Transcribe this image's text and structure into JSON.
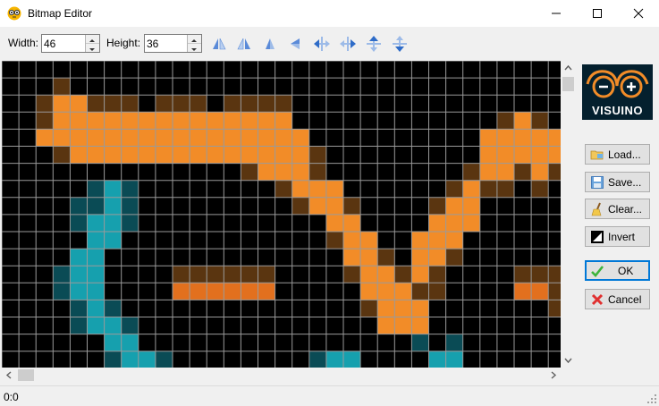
{
  "window": {
    "title": "Bitmap Editor",
    "app_icon": "visuino-owl-icon"
  },
  "toolbar": {
    "width_label": "Width:",
    "width_value": "46",
    "height_label": "Height:",
    "height_value": "36",
    "tools": [
      "mirror-horizontal-left-icon",
      "mirror-horizontal-right-icon",
      "flip-vertical-icon",
      "flip-left-icon",
      "shift-left-icon",
      "shift-right-icon",
      "shift-up-icon",
      "shift-down-icon"
    ]
  },
  "logo": {
    "text": "VISUINO"
  },
  "buttons": {
    "load": "Load...",
    "save": "Save...",
    "clear": "Clear...",
    "invert": "Invert",
    "ok": "OK",
    "cancel": "Cancel"
  },
  "status": {
    "text": "0:0"
  },
  "colors": {
    "orange": "#f28c28",
    "dark_orange": "#e2701e",
    "brown": "#5a3510",
    "teal": "#16a0ae",
    "dark_teal": "#0a4b55",
    "grid": "#9a9a9a",
    "accent": "#0078d7"
  }
}
